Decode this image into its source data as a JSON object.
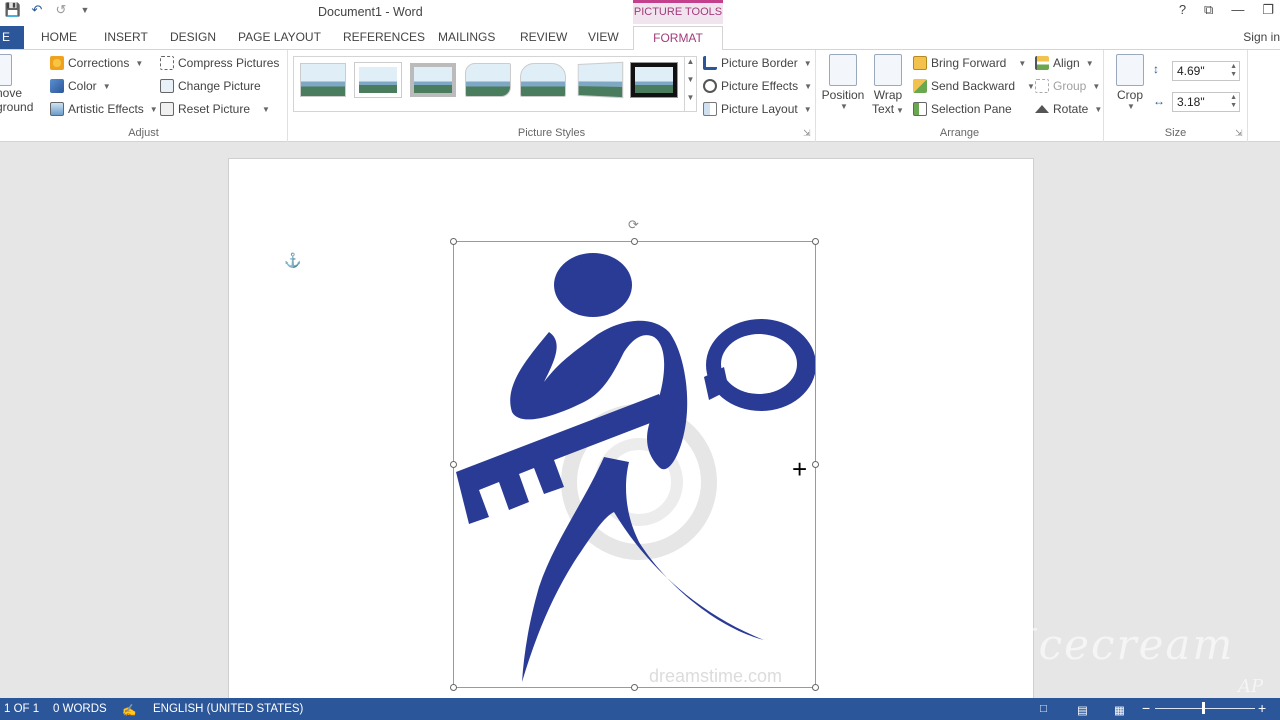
{
  "window": {
    "title": "Document1 - Word",
    "context_tab_group": "PICTURE TOOLS",
    "controls": [
      "?",
      "⧉",
      "—",
      "❐"
    ]
  },
  "qat": {
    "save_icon": "save-icon",
    "undo_icon": "undo-icon",
    "redo_icon": "redo-icon",
    "customize_icon": "customize-icon"
  },
  "tabs": {
    "file": "E",
    "items": [
      "HOME",
      "INSERT",
      "DESIGN",
      "PAGE LAYOUT",
      "REFERENCES",
      "MAILINGS",
      "REVIEW",
      "VIEW"
    ],
    "active": "FORMAT",
    "sign_in": "Sign in"
  },
  "ribbon": {
    "adjust": {
      "label": "Adjust",
      "remove_bg_line1": "nove",
      "remove_bg_line2": "ground",
      "corrections": "Corrections",
      "color": "Color",
      "artistic_effects": "Artistic Effects",
      "compress_pictures": "Compress Pictures",
      "change_picture": "Change Picture",
      "reset_picture": "Reset Picture"
    },
    "picture_styles": {
      "label": "Picture Styles",
      "picture_border": "Picture Border",
      "picture_effects": "Picture Effects",
      "picture_layout": "Picture Layout"
    },
    "arrange": {
      "label": "Arrange",
      "position": "Position",
      "wrap_text_line1": "Wrap",
      "wrap_text_line2": "Text",
      "bring_forward": "Bring Forward",
      "send_backward": "Send Backward",
      "selection_pane": "Selection Pane",
      "align": "Align",
      "group": "Group",
      "rotate": "Rotate"
    },
    "size": {
      "label": "Size",
      "crop": "Crop",
      "height": "4.69\"",
      "width": "3.18\""
    }
  },
  "document": {
    "picture_watermark": "dreamstime.com"
  },
  "status": {
    "page": "1 OF 1",
    "words": "0 WORDS",
    "language": "ENGLISH (UNITED STATES)"
  },
  "overlay": {
    "watermark": "Icecream",
    "watermark2": "AP"
  },
  "colors": {
    "accent": "#2b579a",
    "context": "#a33a7a",
    "logo_blue": "#2a3b96"
  }
}
